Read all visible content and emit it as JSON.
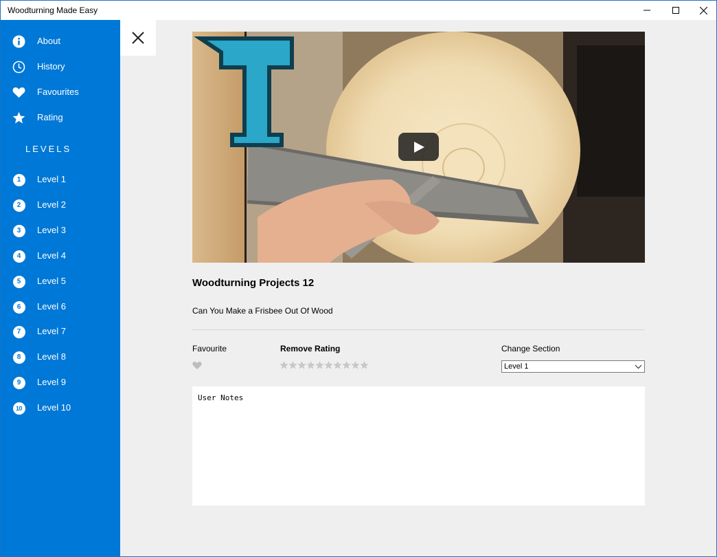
{
  "window": {
    "title": "Woodturning Made Easy"
  },
  "sidebar": {
    "menu": [
      {
        "label": "About",
        "icon": "info-icon"
      },
      {
        "label": "History",
        "icon": "clock-icon"
      },
      {
        "label": "Favourites",
        "icon": "heart-icon"
      },
      {
        "label": "Rating",
        "icon": "star-icon"
      }
    ],
    "levels_heading": "LEVELS",
    "levels": [
      {
        "num": "1",
        "label": "Level 1"
      },
      {
        "num": "2",
        "label": "Level 2"
      },
      {
        "num": "3",
        "label": "Level 3"
      },
      {
        "num": "4",
        "label": "Level 4"
      },
      {
        "num": "5",
        "label": "Level 5"
      },
      {
        "num": "6",
        "label": "Level 6"
      },
      {
        "num": "7",
        "label": "Level 7"
      },
      {
        "num": "8",
        "label": "Level 8"
      },
      {
        "num": "9",
        "label": "Level 9"
      },
      {
        "num": "10",
        "label": "Level 10"
      }
    ]
  },
  "video": {
    "title": "Woodturning Projects 12",
    "description": "Can You Make a Frisbee Out Of Wood",
    "thumbnail_letter": "T"
  },
  "details": {
    "favourite_label": "Favourite",
    "rating_label": "Remove Rating",
    "rating_value": 0,
    "rating_max": 10,
    "section_label": "Change Section",
    "section_selected": "Level 1"
  },
  "notes": {
    "placeholder": "User Notes"
  },
  "colors": {
    "sidebar": "#0078d7",
    "content_bg": "#efefef",
    "star_empty": "#c8c8c8",
    "heart_empty": "#bdbdbd"
  }
}
